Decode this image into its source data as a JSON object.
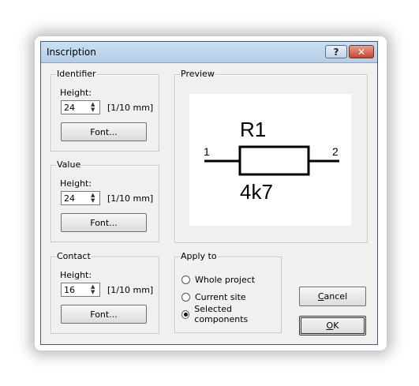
{
  "dialog": {
    "title": "Inscription",
    "help_label": "?",
    "close_label": "✕"
  },
  "identifier": {
    "legend": "Identifier",
    "height_label": "Height:",
    "height_value": "24",
    "unit": "[1/10 mm]",
    "font_button": "Font..."
  },
  "value": {
    "legend": "Value",
    "height_label": "Height:",
    "height_value": "24",
    "unit": "[1/10 mm]",
    "font_button": "Font..."
  },
  "contact": {
    "legend": "Contact",
    "height_label": "Height:",
    "height_value": "16",
    "unit": "[1/10 mm]",
    "font_button": "Font..."
  },
  "preview": {
    "legend": "Preview",
    "component_name": "R1",
    "component_value": "4k7",
    "pin1": "1",
    "pin2": "2"
  },
  "apply_to": {
    "legend": "Apply to",
    "options": [
      {
        "label": "Whole project",
        "selected": false
      },
      {
        "label": "Current site",
        "selected": false
      },
      {
        "label": "Selected components",
        "selected": true
      }
    ]
  },
  "buttons": {
    "cancel_first": "C",
    "cancel_rest": "ancel",
    "ok_first": "O",
    "ok_rest": "K"
  }
}
